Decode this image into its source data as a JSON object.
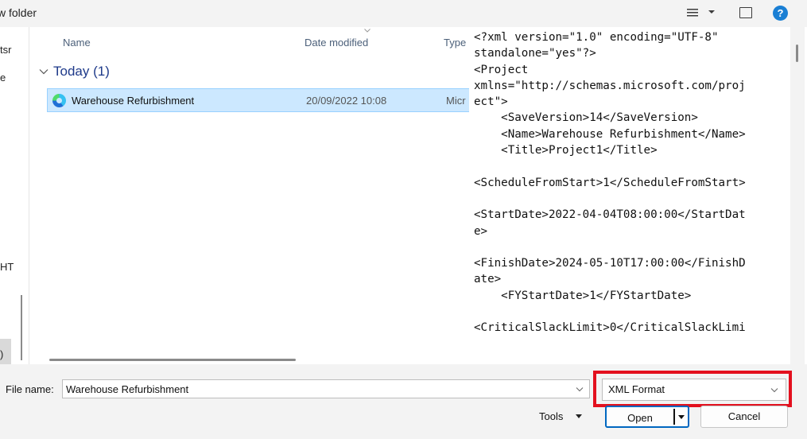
{
  "toolbar": {
    "new_folder_label": "w folder"
  },
  "nav": {
    "fragments": [
      "tsr",
      "e",
      "HT",
      ")"
    ]
  },
  "file_list": {
    "columns": [
      "Name",
      "Date modified",
      "Type"
    ],
    "group_label": "Today (1)",
    "rows": [
      {
        "name": "Warehouse Refurbishment",
        "date": "20/09/2022 10:08",
        "type": "Micr",
        "icon": "edge-icon"
      }
    ]
  },
  "preview": {
    "lines": [
      "<?xml version=\"1.0\" encoding=\"UTF-8\"",
      "standalone=\"yes\"?>",
      "<Project",
      "xmlns=\"http://schemas.microsoft.com/proj",
      "ect\">",
      "    <SaveVersion>14</SaveVersion>",
      "    <Name>Warehouse Refurbishment</Name>",
      "    <Title>Project1</Title>",
      "",
      "<ScheduleFromStart>1</ScheduleFromStart>",
      "",
      "<StartDate>2022-04-04T08:00:00</StartDat",
      "e>",
      "",
      "<FinishDate>2024-05-10T17:00:00</FinishD",
      "ate>",
      "    <FYStartDate>1</FYStartDate>",
      "",
      "<CriticalSlackLimit>0</CriticalSlackLimi"
    ]
  },
  "bottom": {
    "file_name_label": "File name:",
    "file_name_value": "Warehouse Refurbishment",
    "file_type_value": "XML Format",
    "tools_label": "Tools",
    "open_label": "Open",
    "cancel_label": "Cancel"
  },
  "colors": {
    "selection": "#cce8ff",
    "accent": "#0067c0",
    "highlight": "#e3101e"
  }
}
